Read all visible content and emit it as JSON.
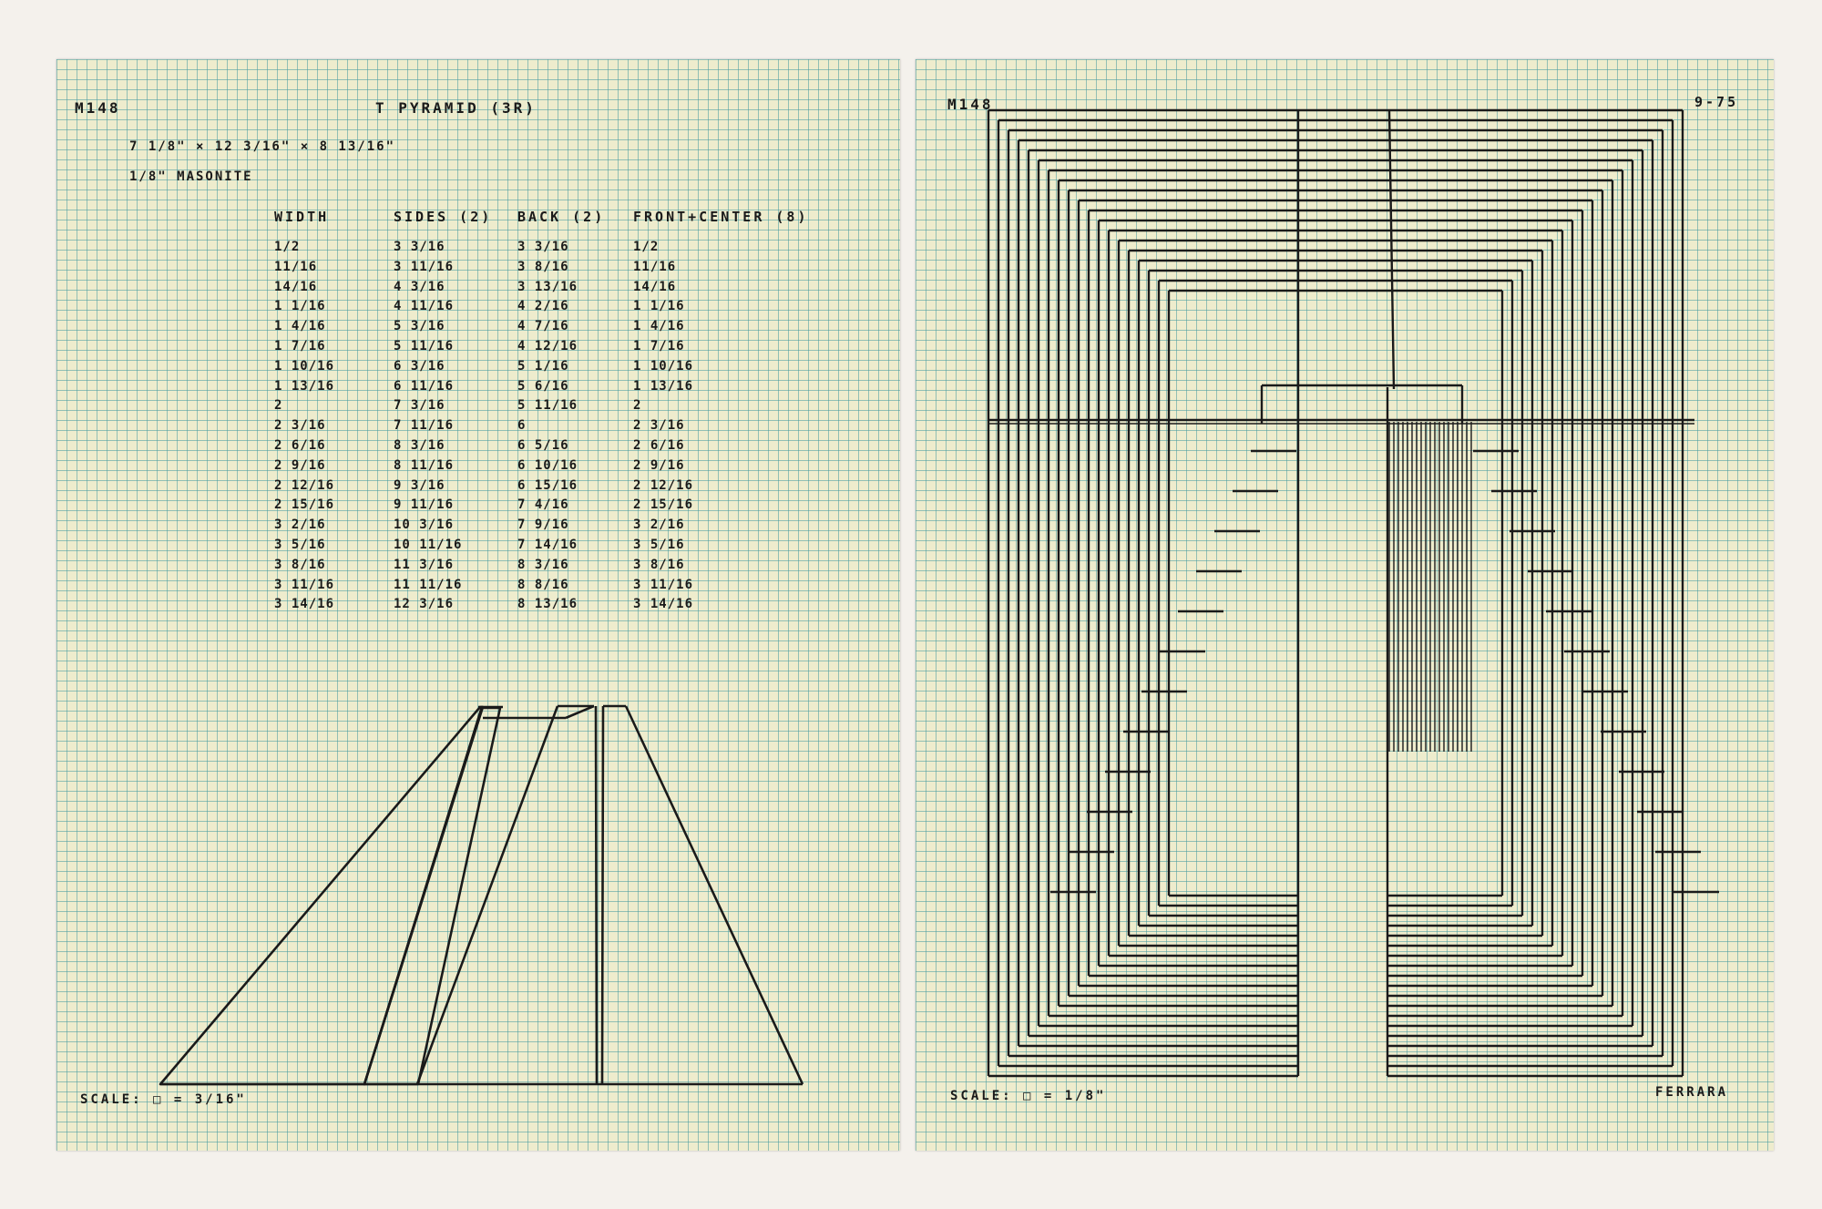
{
  "left": {
    "id": "M148",
    "title": "T PYRAMID (3R)",
    "dimensions": "7 1/8\" × 12 3/16\" × 8 13/16\"",
    "material": "1/8\" MASONITE",
    "scale": "SCALE: □ = 3/16\"",
    "table": {
      "headers": [
        "WIDTH",
        "SIDES (2)",
        "BACK (2)",
        "FRONT+CENTER (8)"
      ],
      "width": [
        "1/2",
        "11/16",
        "14/16",
        "1 1/16",
        "1 4/16",
        "1 7/16",
        "1 10/16",
        "1 13/16",
        "2",
        "2 3/16",
        "2 6/16",
        "2 9/16",
        "2 12/16",
        "2 15/16",
        "3 2/16",
        "3 5/16",
        "3 8/16",
        "3 11/16",
        "3 14/16"
      ],
      "sides": [
        "3 3/16",
        "3 11/16",
        "4 3/16",
        "4 11/16",
        "5 3/16",
        "5 11/16",
        "6 3/16",
        "6 11/16",
        "7 3/16",
        "7 11/16",
        "8 3/16",
        "8 11/16",
        "9 3/16",
        "9 11/16",
        "10 3/16",
        "10 11/16",
        "11 3/16",
        "11 11/16",
        "12 3/16"
      ],
      "back": [
        "3 3/16",
        "3 8/16",
        "3 13/16",
        "4 2/16",
        "4 7/16",
        "4 12/16",
        "5 1/16",
        "5 6/16",
        "5 11/16",
        "6",
        "6 5/16",
        "6 10/16",
        "6 15/16",
        "7 4/16",
        "7 9/16",
        "7 14/16",
        "8 3/16",
        "8 8/16",
        "8 13/16"
      ],
      "front_center": [
        "1/2",
        "11/16",
        "14/16",
        "1 1/16",
        "1 4/16",
        "1 7/16",
        "1 10/16",
        "1 13/16",
        "2",
        "2 3/16",
        "2 6/16",
        "2 9/16",
        "2 12/16",
        "2 15/16",
        "3 2/16",
        "3 5/16",
        "3 8/16",
        "3 11/16",
        "3 14/16"
      ]
    }
  },
  "right": {
    "id": "M148",
    "date": "9-75",
    "scale": "SCALE: □ = 1/8\"",
    "signature": "FERRARA"
  },
  "colors": {
    "paper": "#eeeccd",
    "grid": "#469ba0",
    "ink": "#1a1a1a",
    "mat": "#f4f1ec"
  }
}
